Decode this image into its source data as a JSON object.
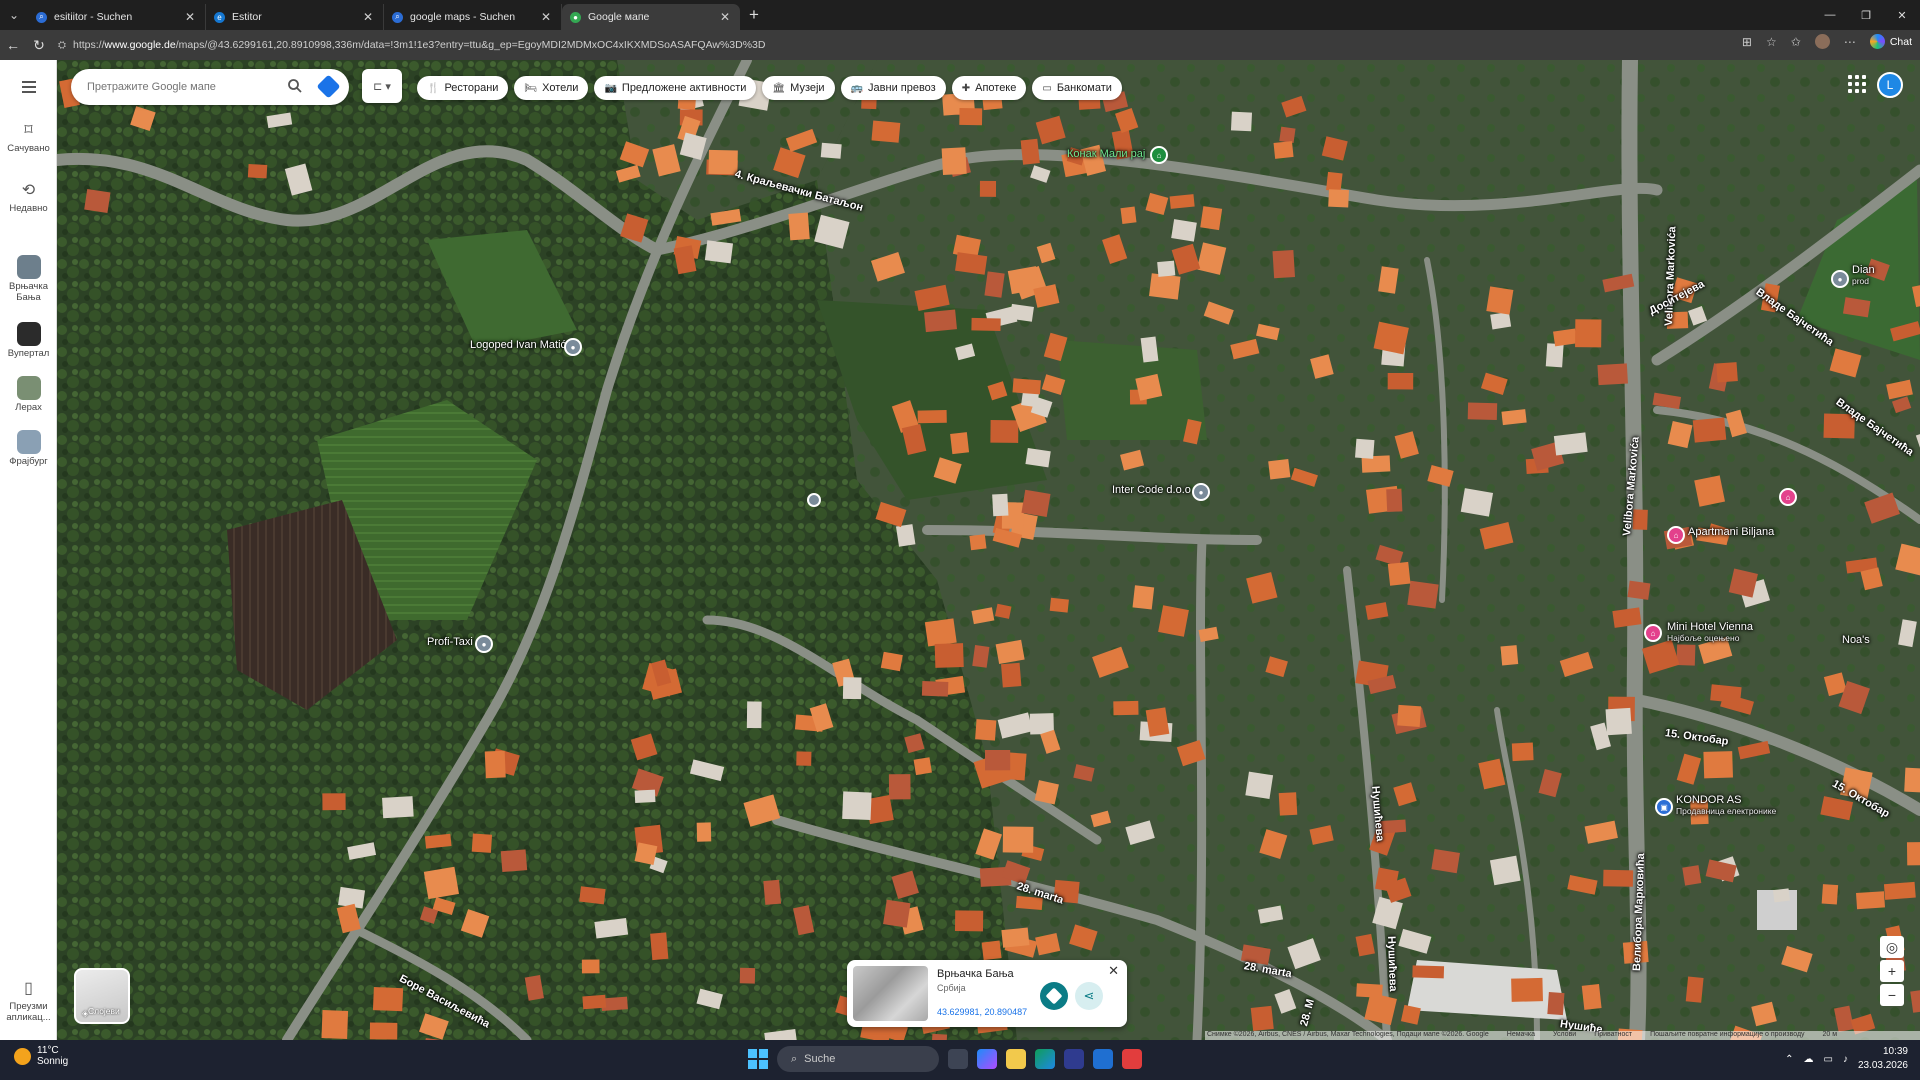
{
  "browser": {
    "tabs": [
      {
        "label": "esitiitor - Suchen",
        "icon": "search-icon",
        "active": false
      },
      {
        "label": "Estitor",
        "icon": "site-icon",
        "active": false
      },
      {
        "label": "google maps - Suchen",
        "icon": "search-icon",
        "active": false
      },
      {
        "label": "Google мапе",
        "icon": "maps-pin-icon",
        "active": true
      }
    ],
    "url_prefix": "https://",
    "url_domain": "www.google.de",
    "url_path": "/maps/@43.6299161,20.8910998,336m/data=!3m1!1e3?entry=ttu&g_ep=EgoyMDI2MDMxOC4xIKXMDSoASAFQAw%3D%3D",
    "chat_label": "Chat"
  },
  "sidebar": {
    "saved_label": "Сачувано",
    "recent_label": "Недавно",
    "recents": [
      {
        "label": "Врњачка Бања",
        "color": "#6d7f8c"
      },
      {
        "label": "Вупертал",
        "color": "#2b2b2b"
      },
      {
        "label": "Лерах",
        "color": "#7a8f73"
      },
      {
        "label": "Фрајбург",
        "color": "#8aa0b4"
      }
    ],
    "download_label": "Преузми апликац..."
  },
  "search": {
    "placeholder": "Претражите Google мапе"
  },
  "chips": [
    {
      "label": "Ресторани",
      "icon": "fork-knife-icon",
      "glyph": "🍴"
    },
    {
      "label": "Хотели",
      "icon": "bed-icon",
      "glyph": "🛏"
    },
    {
      "label": "Предложене активности",
      "icon": "camera-icon",
      "glyph": "📷"
    },
    {
      "label": "Музеји",
      "icon": "museum-icon",
      "glyph": "🏛"
    },
    {
      "label": "Јавни превоз",
      "icon": "bus-icon",
      "glyph": "🚌"
    },
    {
      "label": "Апотеке",
      "icon": "pharmacy-icon",
      "glyph": "✚"
    },
    {
      "label": "Банкомати",
      "icon": "atm-icon",
      "glyph": "▭"
    }
  ],
  "avatar_letter": "L",
  "places": {
    "konak": "Конак Мали рај",
    "logoped": "Logoped Ivan Matić",
    "intercode": "Inter Code d.o.o",
    "profi": "Profi-Taxi",
    "biljana": "Apartmani Biljana",
    "vienna": "Mini Hotel Vienna",
    "vienna_sub": "Најбоље оцењено",
    "kondor": "KONDOR AS",
    "kondor_sub": "Продавница електронике",
    "dian": "Dian",
    "dian_sub": "prod",
    "noas": "Noa's"
  },
  "streets": {
    "kraljevacki": "4. Краљевачки Батаљон",
    "velibora_1": "Velibora Markovića",
    "velibora_2": "Velibora Markovića",
    "velibora_3": "Велибора Марковића",
    "dositejeva": "Доситејева",
    "vlade_1": "Владе Бајчетића",
    "vlade_2": "Владе Бајчетића",
    "oktobar_1": "15. Октобар",
    "oktobar_2": "15. Октобар",
    "marta_1": "28. marta",
    "marta_2": "28. marta",
    "marta_3": "28. M",
    "nusiceva_1": "Нушићева",
    "nusiceva_2": "Нушићева",
    "nusiceva_3": "Нушиће",
    "bore": "Боре Васиљевића"
  },
  "info_card": {
    "title": "Врњачка Бања",
    "country": "Србија",
    "coords": "43.629981, 20.890487"
  },
  "layers_label": "Слојеви",
  "attribution": {
    "imagery": "Снимке ©2026, Airbus, CNES / Airbus, Maxar Technologies, Подаци мапе ©2026. Google",
    "germany": "Немачка",
    "terms": "Услови",
    "privacy": "Приватност",
    "feedback": "Пошаљите повратне информације о производу",
    "scale": "20 м"
  },
  "taskbar": {
    "temperature": "11°C",
    "weather": "Sonnig",
    "search": "Suche",
    "time": "10:39",
    "date": "23.03.2026"
  },
  "colors": {
    "roof": "#e07a3f",
    "road": "#8a8f86",
    "forest": "#2a4024",
    "pin_pink": "#e3418c",
    "pin_green": "#1e8e3e",
    "accent_blue": "#1a73e8"
  }
}
